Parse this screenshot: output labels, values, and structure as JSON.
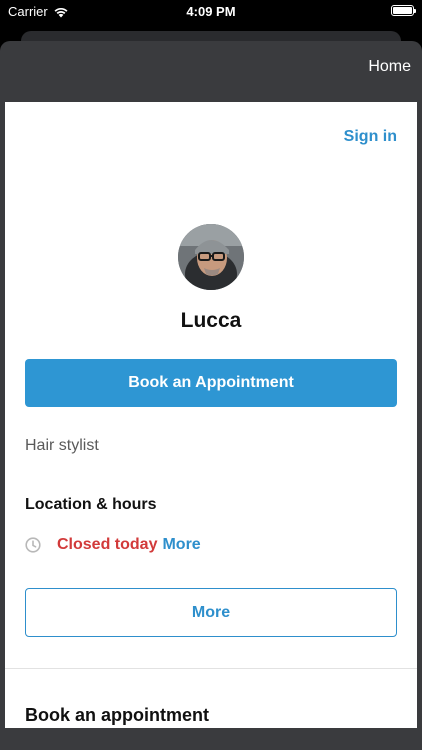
{
  "status_bar": {
    "carrier": "Carrier",
    "time": "4:09 PM",
    "icons": [
      "wifi-icon",
      "battery-icon"
    ]
  },
  "nav": {
    "home_label": "Home"
  },
  "header": {
    "sign_in_label": "Sign in"
  },
  "profile": {
    "name": "Lucca",
    "avatar": "avatar-photo",
    "book_button_label": "Book an Appointment",
    "category": "Hair stylist"
  },
  "location": {
    "heading": "Location & hours",
    "status_text": "Closed today",
    "status_more_label": "More",
    "clock_icon": "clock-icon",
    "more_button_label": "More"
  },
  "booking": {
    "heading": "Book an appointment"
  },
  "colors": {
    "accent": "#2e96d3",
    "link": "#2e8fcc",
    "closed": "#d23a3a",
    "chrome": "#3a3b3e"
  }
}
